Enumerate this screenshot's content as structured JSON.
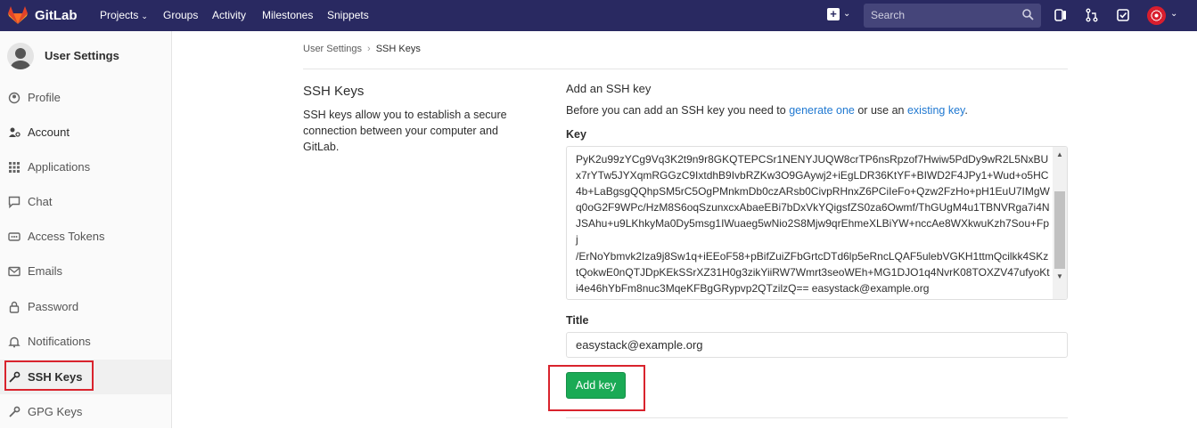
{
  "app": {
    "name": "GitLab"
  },
  "topnav": {
    "links": [
      "Projects",
      "Groups",
      "Activity",
      "Milestones",
      "Snippets"
    ],
    "search_placeholder": "Search"
  },
  "sidebar": {
    "title": "User Settings",
    "items": [
      {
        "label": "Profile",
        "icon": "profile-icon"
      },
      {
        "label": "Account",
        "icon": "account-icon"
      },
      {
        "label": "Applications",
        "icon": "applications-icon"
      },
      {
        "label": "Chat",
        "icon": "chat-icon"
      },
      {
        "label": "Access Tokens",
        "icon": "access-tokens-icon"
      },
      {
        "label": "Emails",
        "icon": "email-icon"
      },
      {
        "label": "Password",
        "icon": "lock-icon"
      },
      {
        "label": "Notifications",
        "icon": "bell-icon"
      },
      {
        "label": "SSH Keys",
        "icon": "key-icon",
        "active": true
      },
      {
        "label": "GPG Keys",
        "icon": "key-icon"
      }
    ]
  },
  "breadcrumb": {
    "parent": "User Settings",
    "current": "SSH Keys"
  },
  "section": {
    "title": "SSH Keys",
    "description": "SSH keys allow you to establish a secure connection between your computer and GitLab."
  },
  "form": {
    "title": "Add an SSH key",
    "help_prefix": "Before you can add an SSH key you need to",
    "help_link1": "generate one",
    "help_middle": "or use an",
    "help_link2": "existing key",
    "help_suffix": ".",
    "key_label": "Key",
    "key_value": "PyK2u99zYCg9Vq3K2t9n9r8GKQTEPCSr1NENYJUQW8crTP6nsRpzof7Hwiw5PdDy9wR2L5NxBUx7rYTw5JYXqmRGGzC9IxtdhB9IvbRZKw3O9GAywj2+iEgLDR36KtYF+BIWD2F4JPy1+Wud+o5HC4b+LaBgsgQQhpSM5rC5OgPMnkmDb0czARsb0CivpRHnxZ6PCiIeFo+Qzw2FzHo+pH1EuU7IMgWq0oG2F9WPc/HzM8S6oqSzunxcxAbaeEBi7bDxVkYQigsfZS0za6Owmf/ThGUgM4u1TBNVRga7i4NJSAhu+u9LKhkyMa0Dy5msg1IWuaeg5wNio2S8Mjw9qrEhmeXLBiYW+nccAe8WXkwuKzh7Sou+Fpj\n/ErNoYbmvk2Iza9j8Sw1q+iEEoF58+pBifZuiZFbGrtcDTd6lp5eRncLQAF5ulebVGKH1ttmQcilkk4SKztQokwE0nQTJDpKEkSSrXZ31H0g3zikYiiRW7Wmrt3seoWEh+MG1DJO1q4NvrK08TOXZV47ufyoKti4e46hYbFm8nuc3MqeKFBgGRypvp2QTzilzQ== easystack@example.org",
    "title_label": "Title",
    "title_value": "easystack@example.org",
    "submit_label": "Add key"
  },
  "colors": {
    "navbar": "#292961",
    "success": "#1aaa55",
    "link": "#1f78d1",
    "annotation": "#d9232d"
  }
}
